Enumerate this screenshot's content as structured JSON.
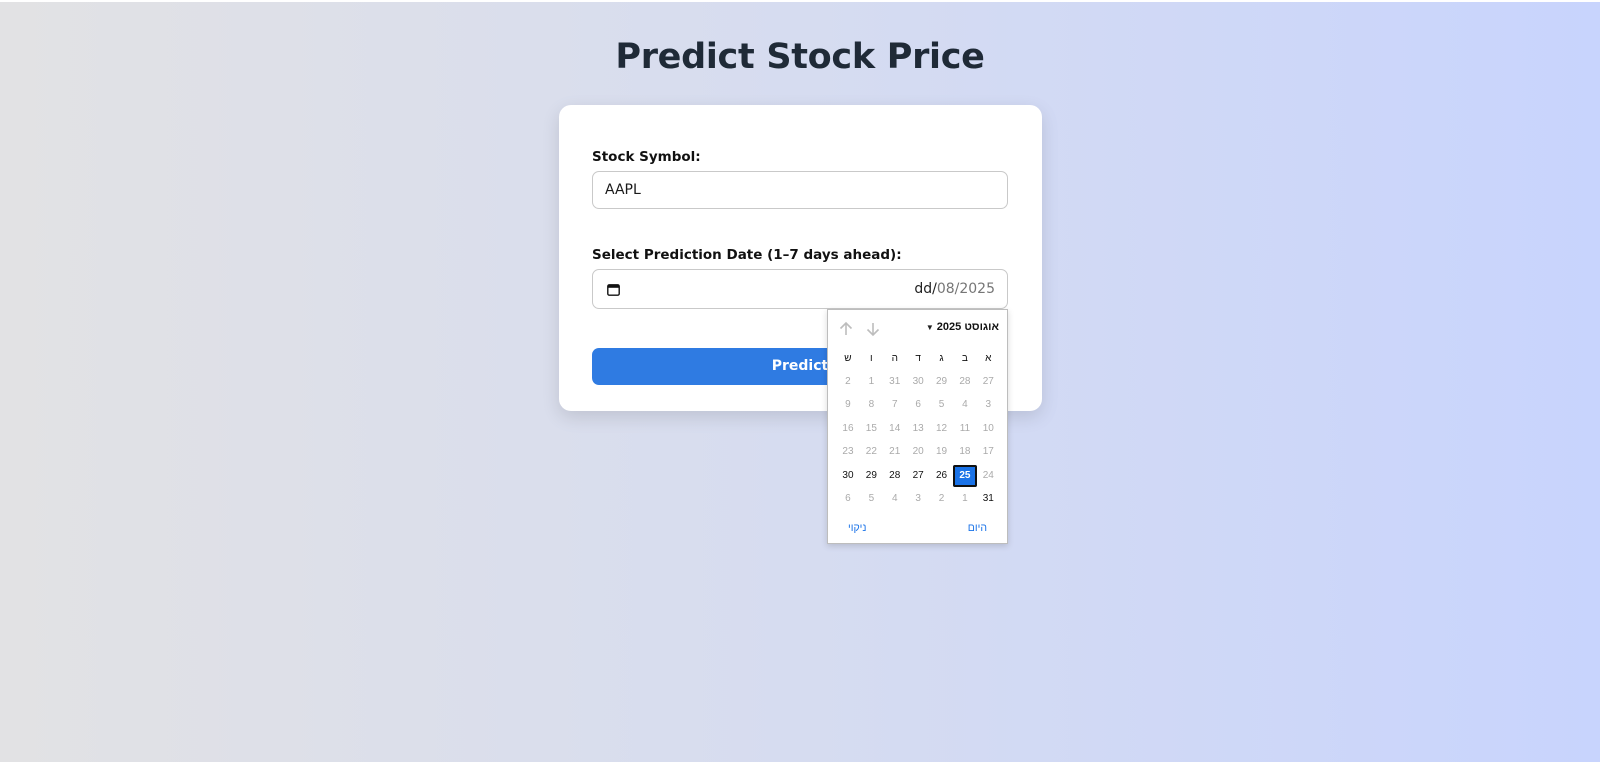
{
  "page": {
    "title": "Predict Stock Price"
  },
  "form": {
    "symbol_label": "Stock Symbol:",
    "symbol_value": "AAPL",
    "date_label": "Select Prediction Date (1–7 days ahead):",
    "date_value": {
      "day": "dd",
      "separator1": "/",
      "month": "08",
      "separator2": "/",
      "year": "2025"
    },
    "predict_button_label": "Predict",
    "calendar_icon": "calendar-icon"
  },
  "datepicker": {
    "month_year_label": "אוגוסט 2025",
    "caret_icon": "caret-down-icon",
    "prev_icon": "arrow-up-icon",
    "next_icon": "arrow-down-icon",
    "weekdays": [
      "א",
      "ב",
      "ג",
      "ד",
      "ה",
      "ו",
      "ש"
    ],
    "weeks": [
      [
        {
          "d": "27",
          "c": false
        },
        {
          "d": "28",
          "c": false
        },
        {
          "d": "29",
          "c": false
        },
        {
          "d": "30",
          "c": false
        },
        {
          "d": "31",
          "c": false
        },
        {
          "d": "1",
          "c": false
        },
        {
          "d": "2",
          "c": false
        }
      ],
      [
        {
          "d": "3",
          "c": false
        },
        {
          "d": "4",
          "c": false
        },
        {
          "d": "5",
          "c": false
        },
        {
          "d": "6",
          "c": false
        },
        {
          "d": "7",
          "c": false
        },
        {
          "d": "8",
          "c": false
        },
        {
          "d": "9",
          "c": false
        }
      ],
      [
        {
          "d": "10",
          "c": false
        },
        {
          "d": "11",
          "c": false
        },
        {
          "d": "12",
          "c": false
        },
        {
          "d": "13",
          "c": false
        },
        {
          "d": "14",
          "c": false
        },
        {
          "d": "15",
          "c": false
        },
        {
          "d": "16",
          "c": false
        }
      ],
      [
        {
          "d": "17",
          "c": false
        },
        {
          "d": "18",
          "c": false
        },
        {
          "d": "19",
          "c": false
        },
        {
          "d": "20",
          "c": false
        },
        {
          "d": "21",
          "c": false
        },
        {
          "d": "22",
          "c": false
        },
        {
          "d": "23",
          "c": false
        }
      ],
      [
        {
          "d": "24",
          "c": false
        },
        {
          "d": "25",
          "c": true,
          "selected": true
        },
        {
          "d": "26",
          "c": true
        },
        {
          "d": "27",
          "c": true
        },
        {
          "d": "28",
          "c": true
        },
        {
          "d": "29",
          "c": true
        },
        {
          "d": "30",
          "c": true
        }
      ],
      [
        {
          "d": "31",
          "c": true
        },
        {
          "d": "1",
          "c": false
        },
        {
          "d": "2",
          "c": false
        },
        {
          "d": "3",
          "c": false
        },
        {
          "d": "4",
          "c": false
        },
        {
          "d": "5",
          "c": false
        },
        {
          "d": "6",
          "c": false
        }
      ]
    ],
    "today_label": "היום",
    "clear_label": "ניקוי"
  },
  "colors": {
    "primary": "#2f7be2",
    "selected_day": "#1a73e8",
    "title_text": "#1f2a37"
  }
}
